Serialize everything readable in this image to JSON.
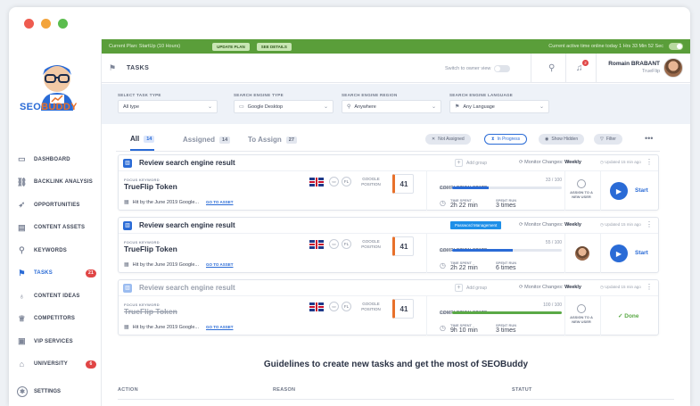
{
  "window": {
    "dots": [
      "#ee5b4f",
      "#f3a43b",
      "#5bbd4e"
    ]
  },
  "brand": {
    "logo_text_a": "SEO",
    "logo_text_b": "BUDDY"
  },
  "sidebar": {
    "items": [
      {
        "label": "DASHBOARD",
        "icon": "monitor-icon",
        "glyph": "▭"
      },
      {
        "label": "BACKLINK ANALYSIS",
        "icon": "network-icon",
        "glyph": "⛓"
      },
      {
        "label": "OPPORTUNITIES",
        "icon": "rocket-icon",
        "glyph": "➶"
      },
      {
        "label": "CONTENT ASSETS",
        "icon": "document-icon",
        "glyph": "▤"
      },
      {
        "label": "KEYWORDS",
        "icon": "keyword-icon",
        "glyph": "⚲"
      },
      {
        "label": "TASKS",
        "icon": "tasks-icon",
        "glyph": "⚑",
        "badge": "21",
        "active": true
      },
      {
        "label": "CONTENT IDEAS",
        "icon": "lightbulb-icon",
        "glyph": "♁"
      },
      {
        "label": "COMPETITORS",
        "icon": "trophy-icon",
        "glyph": "♕"
      },
      {
        "label": "VIP SERVICES",
        "icon": "vip-icon",
        "glyph": "▣"
      },
      {
        "label": "UNIVERSITY",
        "icon": "graduation-icon",
        "glyph": "⌂",
        "badge": "6"
      }
    ],
    "settings": "SETTINGS"
  },
  "planbar": {
    "plan": "Current Plan: StartUp (10 Hours)",
    "update": "UPDATE PLAN",
    "details": "SEE DETAILS",
    "active_time": "Current active time online today 1 Hrs 33 Min 52 Sec"
  },
  "header": {
    "title": "TASKS",
    "owner_view": "Switch to owner view",
    "bell_count": "2",
    "user_name": "Romain BRABANT",
    "user_org": "TrueFlip"
  },
  "filters": [
    {
      "label": "SELECT TASK TYPE",
      "value": "All type",
      "pre": ""
    },
    {
      "label": "SEARCH ENGINE TYPE",
      "value": "Google Desktop",
      "pre": "▭"
    },
    {
      "label": "SEARCH ENGINE REGION",
      "value": "Anywhere",
      "pre": "⚲"
    },
    {
      "label": "SEARCH ENGINE LANGUAGE",
      "value": "Any Language",
      "pre": "⚑"
    }
  ],
  "tabs": [
    {
      "label": "All",
      "count": "14",
      "active": true
    },
    {
      "label": "Assigned",
      "count": "14"
    },
    {
      "label": "To Assign",
      "count": "27"
    }
  ],
  "filter_buttons": [
    {
      "label": "Not Assigned",
      "glyph": "✕"
    },
    {
      "label": "In Progress",
      "glyph": "⧗",
      "selected": true
    },
    {
      "label": "Show Hidden",
      "glyph": "◉"
    },
    {
      "label": "Filter",
      "glyph": "▽"
    }
  ],
  "tasks": [
    {
      "title": "Review search engine result",
      "group": "Add group",
      "monitor_pre": "Monitor Changes: ",
      "monitor_val": "Weekly",
      "updated": "Updated 15 min ago",
      "focus_label": "FOCUS KEYWORD",
      "keyword": "TrueFlip Token",
      "hit": "Hit by the June 2019 Google...",
      "goto": "GO TO ASSET",
      "lang": "FL",
      "gpos_label": "GOOGLE POSITION",
      "position": "41",
      "cs_label": "COMPLETION STATE",
      "cs_ratio": "33 / 100",
      "pct": "33%",
      "progress": 33,
      "bar": "blue",
      "time_label": "TIME SPENT",
      "time": "2h 22 min",
      "spent_label": "SPENT RUN",
      "spent": "3 times",
      "assign": "ASSIGN TO A NEW USER",
      "action": "Start",
      "state": "start"
    },
    {
      "title": "Review search engine result",
      "pill": "Password Management",
      "monitor_pre": "Monitor Changes: ",
      "monitor_val": "Weekly",
      "updated": "Updated 15 min ago",
      "focus_label": "FOCUS KEYWORD",
      "keyword": "TrueFlip Token",
      "hit": "Hit by the June 2019 Google...",
      "goto": "GO TO ASSET",
      "lang": "FL",
      "gpos_label": "GOOGLE POSITION",
      "position": "41",
      "cs_label": "COMPLETION STATE",
      "cs_ratio": "55 / 100",
      "pct": "55%",
      "progress": 55,
      "bar": "blue",
      "time_label": "TIME SPENT",
      "time": "2h 22 min",
      "spent_label": "SPENT RUN",
      "spent": "6 times",
      "action": "Start",
      "state": "assigned"
    },
    {
      "title": "Review search engine result",
      "group": "Add group",
      "monitor_pre": "Monitor Changes: ",
      "monitor_val": "Weekly",
      "updated": "Updated 15 min ago",
      "focus_label": "FOCUS KEYWORD",
      "keyword": "TrueFlip Token",
      "hit": "Hit by the June 2019 Google...",
      "goto": "GO TO ASSET",
      "lang": "FL",
      "gpos_label": "GOOGLE POSITION",
      "position": "41",
      "cs_label": "COMPLETION STATE",
      "cs_ratio": "100 / 100",
      "pct": "100%",
      "progress": 100,
      "bar": "green",
      "time_label": "TIME SPENT",
      "time": "9h 10 min",
      "spent_label": "SPENT RUN",
      "spent": "3 times",
      "assign": "ASSIGN TO A NEW USER",
      "action": "✓ Done",
      "state": "done"
    }
  ],
  "guidelines": {
    "title": "Guidelines to create new tasks and get the most of SEOBuddy",
    "col_action": "ACTION",
    "col_reason": "REASON",
    "col_status": "STATUT"
  }
}
